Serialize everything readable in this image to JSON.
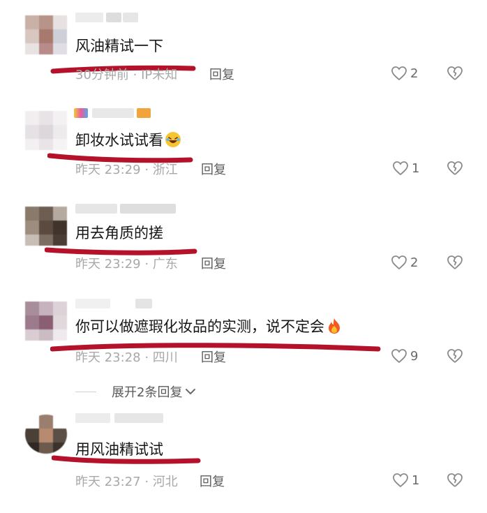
{
  "comments": [
    {
      "text": "风油精试一下",
      "meta": "30分钟前 · IP未知",
      "reply": "回复",
      "likes": "2",
      "emoji": ""
    },
    {
      "text": "卸妆水试试看",
      "meta": "昨天 23:29 · 浙江",
      "reply": "回复",
      "likes": "1",
      "emoji": "rolling-laughing-icon"
    },
    {
      "text": "用去角质的搓",
      "meta": "昨天 23:29 · 广东",
      "reply": "回复",
      "likes": "2",
      "emoji": ""
    },
    {
      "text": "你可以做遮瑕化妆品的实测，说不定会",
      "meta": "昨天 23:28 · 四川",
      "reply": "回复",
      "likes": "9",
      "emoji": "fire-icon"
    },
    {
      "text": "用风油精试试",
      "meta": "昨天 23:27 · 河北",
      "reply": "回复",
      "likes": "1",
      "emoji": ""
    }
  ],
  "expand_label": "展开2条回复",
  "colors": {
    "underline": "#b3122a",
    "meta": "#a8a8a8"
  }
}
